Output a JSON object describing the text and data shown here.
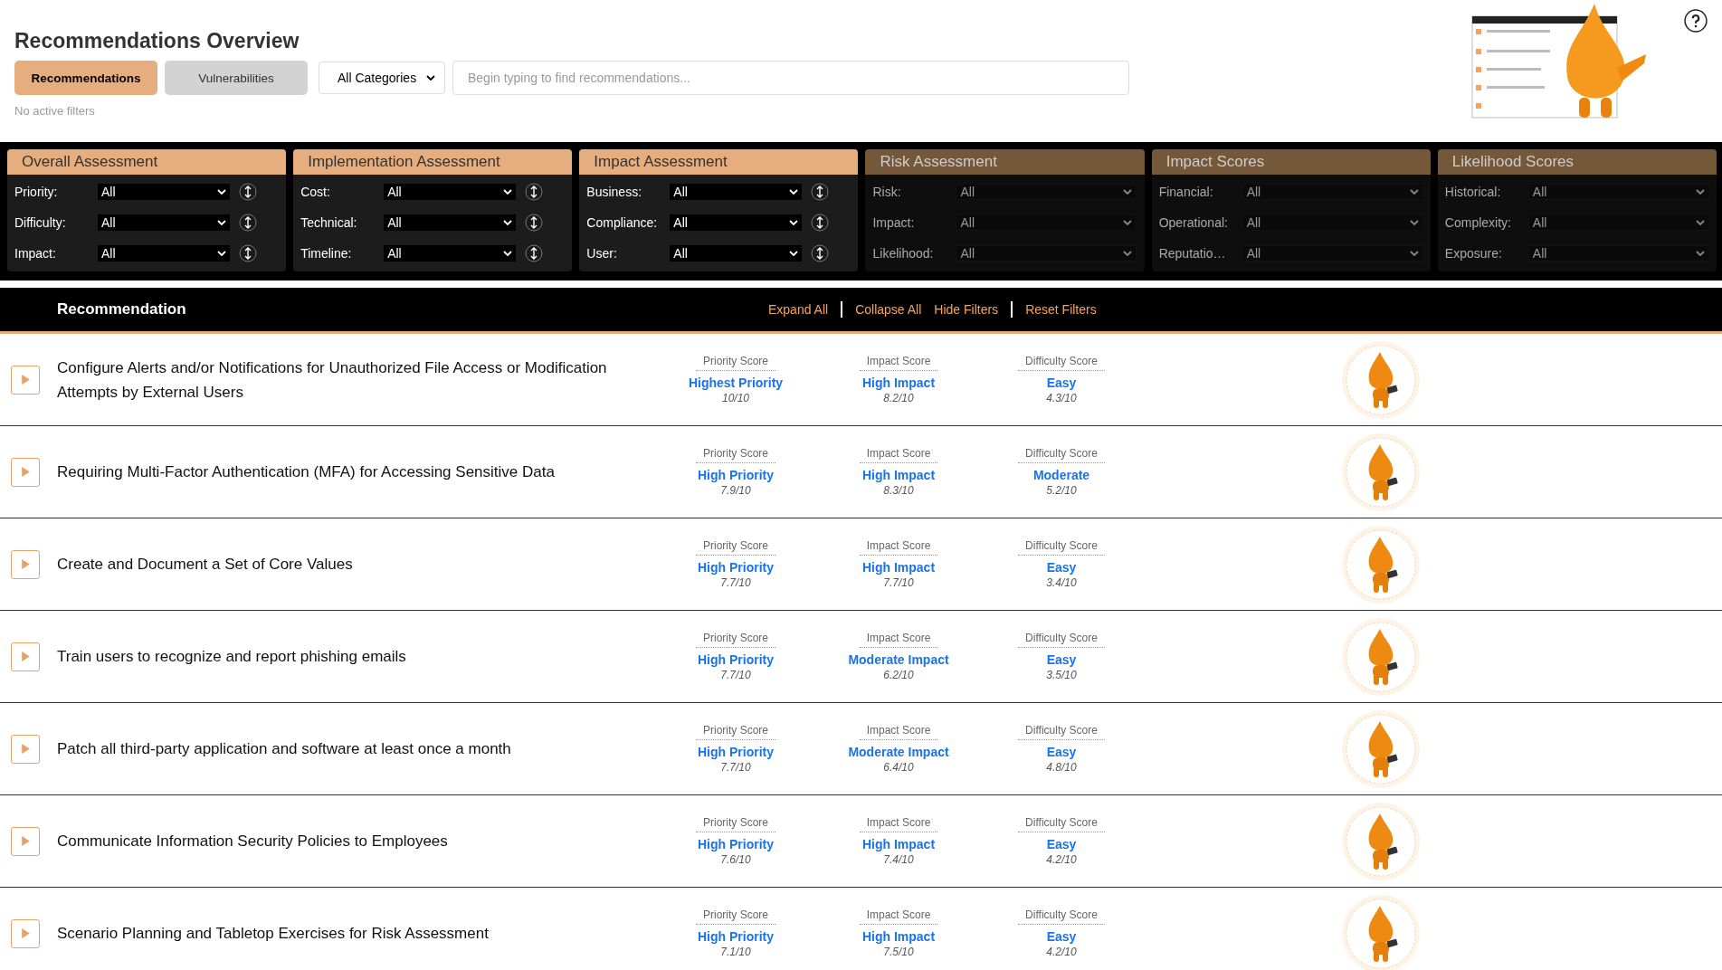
{
  "page_title": "Recommendations Overview",
  "tabs": [
    {
      "label": "Recommendations",
      "selected": true
    },
    {
      "label": "Vulnerabilities",
      "selected": false
    }
  ],
  "category_select": {
    "value": "All Categories"
  },
  "search": {
    "placeholder": "Begin typing to find recommendations..."
  },
  "filter_status": "No active filters",
  "filter_groups": [
    {
      "title": "Overall Assessment",
      "disabled": false,
      "filters": [
        {
          "label": "Priority:",
          "value": "All"
        },
        {
          "label": "Difficulty:",
          "value": "All"
        },
        {
          "label": "Impact:",
          "value": "All"
        }
      ]
    },
    {
      "title": "Implementation Assessment",
      "disabled": false,
      "filters": [
        {
          "label": "Cost:",
          "value": "All"
        },
        {
          "label": "Technical:",
          "value": "All"
        },
        {
          "label": "Timeline:",
          "value": "All"
        }
      ]
    },
    {
      "title": "Impact Assessment",
      "disabled": false,
      "filters": [
        {
          "label": "Business:",
          "value": "All"
        },
        {
          "label": "Compliance:",
          "value": "All"
        },
        {
          "label": "User:",
          "value": "All"
        }
      ]
    },
    {
      "title": "Risk Assessment",
      "disabled": true,
      "filters": [
        {
          "label": "Risk:",
          "value": "All"
        },
        {
          "label": "Impact:",
          "value": "All"
        },
        {
          "label": "Likelihood:",
          "value": "All"
        }
      ]
    },
    {
      "title": "Impact Scores",
      "disabled": true,
      "filters": [
        {
          "label": "Financial:",
          "value": "All"
        },
        {
          "label": "Operational:",
          "value": "All"
        },
        {
          "label": "Reputatio…",
          "value": "All"
        }
      ]
    },
    {
      "title": "Likelihood Scores",
      "disabled": true,
      "filters": [
        {
          "label": "Historical:",
          "value": "All"
        },
        {
          "label": "Complexity:",
          "value": "All"
        },
        {
          "label": "Exposure:",
          "value": "All"
        }
      ]
    }
  ],
  "list_header": {
    "title": "Recommendation",
    "actions": [
      "Expand All",
      "Collapse All",
      "Hide Filters",
      "Reset Filters"
    ]
  },
  "recommendations": [
    {
      "title": "Configure Alerts and/or Notifications for Unauthorized File Access or Modification Attempts by External Users",
      "scores": [
        {
          "label": "Priority Score",
          "value": "Highest Priority",
          "reading": "10/10"
        },
        {
          "label": "Impact Score",
          "value": "High Impact",
          "reading": "8.2/10"
        },
        {
          "label": "Difficulty Score",
          "value": "Easy",
          "reading": "4.3/10"
        }
      ]
    },
    {
      "title": "Requiring Multi-Factor Authentication (MFA) for Accessing Sensitive Data",
      "scores": [
        {
          "label": "Priority Score",
          "value": "High Priority",
          "reading": "7.9/10"
        },
        {
          "label": "Impact Score",
          "value": "High Impact",
          "reading": "8.3/10"
        },
        {
          "label": "Difficulty Score",
          "value": "Moderate",
          "reading": "5.2/10"
        }
      ]
    },
    {
      "title": "Create and Document a Set of Core Values",
      "scores": [
        {
          "label": "Priority Score",
          "value": "High Priority",
          "reading": "7.7/10"
        },
        {
          "label": "Impact Score",
          "value": "High Impact",
          "reading": "7.7/10"
        },
        {
          "label": "Difficulty Score",
          "value": "Easy",
          "reading": "3.4/10"
        }
      ]
    },
    {
      "title": "Train users to recognize and report phishing emails",
      "scores": [
        {
          "label": "Priority Score",
          "value": "High Priority",
          "reading": "7.7/10"
        },
        {
          "label": "Impact Score",
          "value": "Moderate Impact",
          "reading": "6.2/10"
        },
        {
          "label": "Difficulty Score",
          "value": "Easy",
          "reading": "3.5/10"
        }
      ]
    },
    {
      "title": "Patch all third-party application and software at least once a month",
      "scores": [
        {
          "label": "Priority Score",
          "value": "High Priority",
          "reading": "7.7/10"
        },
        {
          "label": "Impact Score",
          "value": "Moderate Impact",
          "reading": "6.4/10"
        },
        {
          "label": "Difficulty Score",
          "value": "Easy",
          "reading": "4.8/10"
        }
      ]
    },
    {
      "title": "Communicate Information Security Policies to Employees",
      "scores": [
        {
          "label": "Priority Score",
          "value": "High Priority",
          "reading": "7.6/10"
        },
        {
          "label": "Impact Score",
          "value": "High Impact",
          "reading": "7.4/10"
        },
        {
          "label": "Difficulty Score",
          "value": "Easy",
          "reading": "4.2/10"
        }
      ]
    },
    {
      "title": "Scenario Planning and Tabletop Exercises for Risk Assessment",
      "scores": [
        {
          "label": "Priority Score",
          "value": "High Priority",
          "reading": "7.1/10"
        },
        {
          "label": "Impact Score",
          "value": "High Impact",
          "reading": "7.5/10"
        },
        {
          "label": "Difficulty Score",
          "value": "Easy",
          "reading": "4.2/10"
        }
      ]
    }
  ]
}
